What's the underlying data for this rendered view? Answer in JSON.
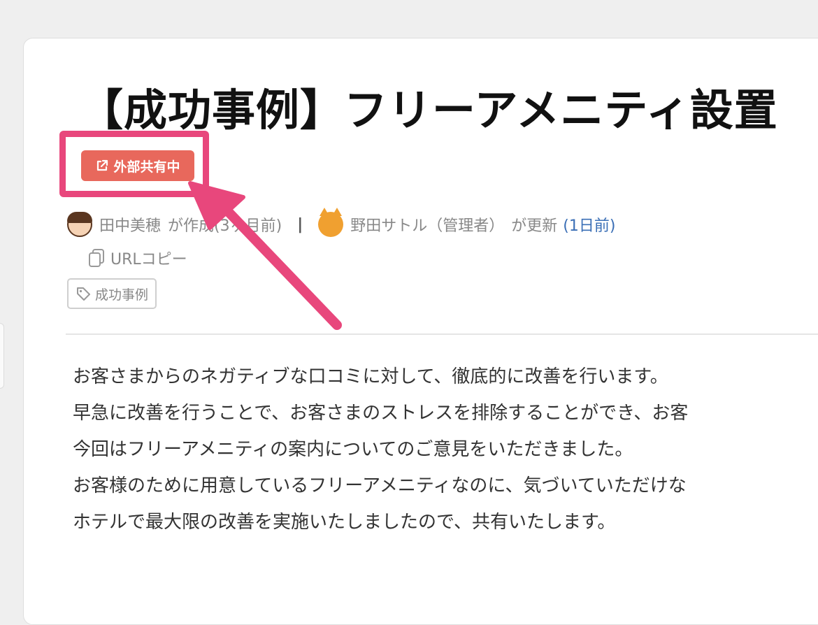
{
  "article": {
    "title": "【成功事例】フリーアメニティ設置",
    "badge": {
      "label": "外部共有中",
      "icon": "external-link-icon",
      "color": "#e8685c"
    },
    "meta": {
      "author": "田中美穂",
      "created_text": "が作成",
      "created_ago": "(3ヶ月前)",
      "separator": "|",
      "updater": "野田サトル（管理者）",
      "updated_text": "が更新",
      "updated_ago": "(1日前)"
    },
    "copy_url_label": "URLコピー",
    "tag": "成功事例",
    "body": [
      "お客さまからのネガティブな口コミに対して、徹底的に改善を行います。",
      "早急に改善を行うことで、お客さまのストレスを排除することができ、お客",
      "今回はフリーアメニティの案内についてのご意見をいただきました。",
      "お客様のために用意しているフリーアメニティなのに、気づいていただけな",
      "ホテルで最大限の改善を実施いたしましたので、共有いたします。"
    ]
  },
  "annotation": {
    "highlight_color": "#e8477c"
  }
}
